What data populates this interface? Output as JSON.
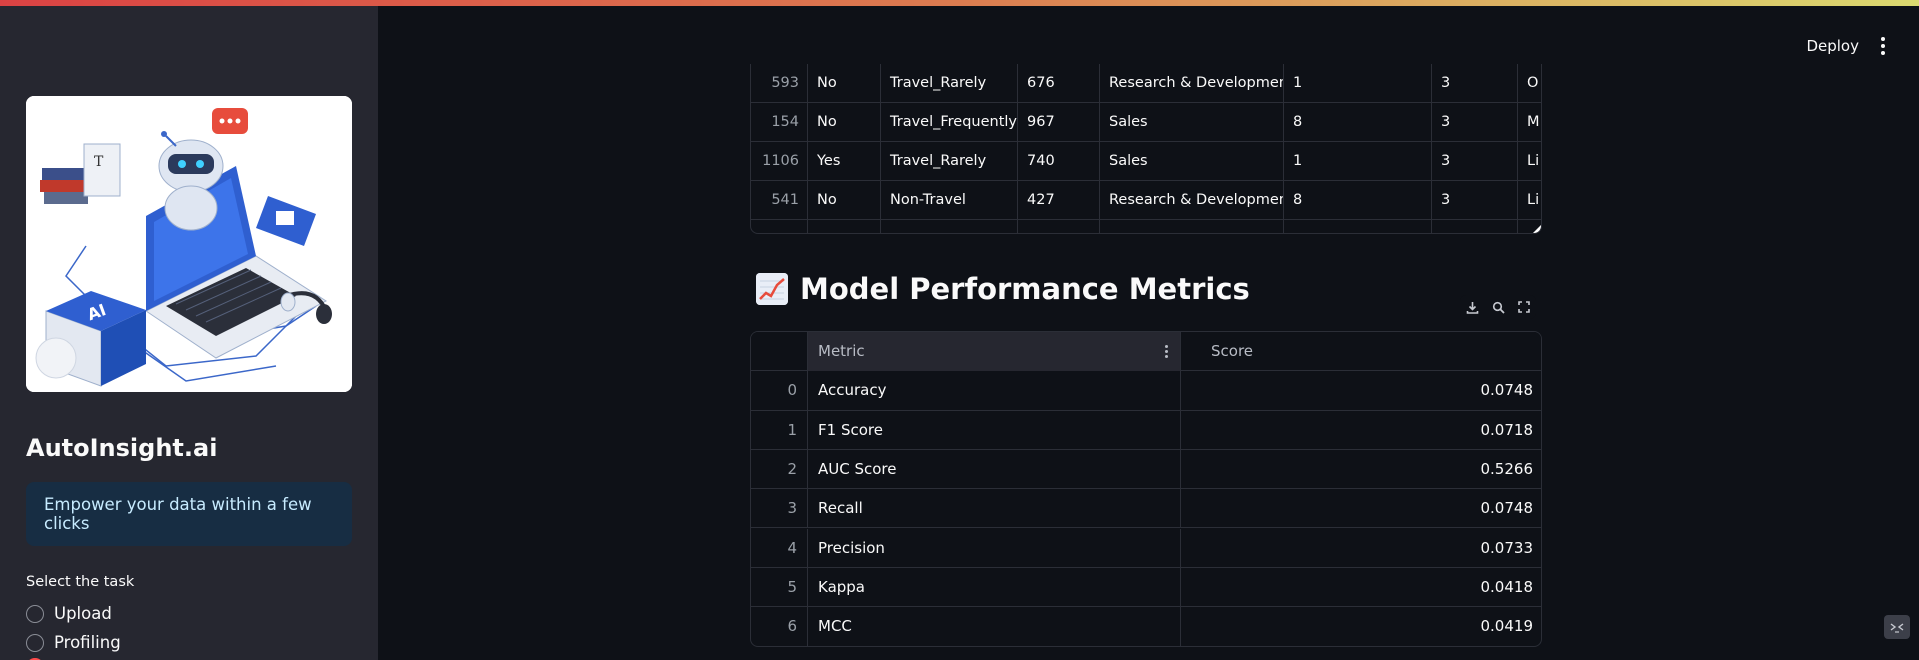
{
  "header": {
    "deploy_label": "Deploy",
    "menu_icon": "kebab-icon"
  },
  "sidebar": {
    "app_title": "AutoInsight.ai",
    "tagline": "Empower your data within a few clicks",
    "task_label": "Select the task",
    "tasks": [
      {
        "label": "Upload",
        "selected": false
      },
      {
        "label": "Profiling",
        "selected": false
      },
      {
        "label": "",
        "selected": true
      }
    ],
    "hero_image_text": "AI"
  },
  "dataset_preview": {
    "rows": [
      {
        "index": "593",
        "c1": "No",
        "c2": "Travel_Rarely",
        "c3": "676",
        "c4": "Research & Development",
        "c5": "1",
        "c6": "3",
        "c7": "O"
      },
      {
        "index": "154",
        "c1": "No",
        "c2": "Travel_Frequently",
        "c3": "967",
        "c4": "Sales",
        "c5": "8",
        "c6": "3",
        "c7": "M"
      },
      {
        "index": "1106",
        "c1": "Yes",
        "c2": "Travel_Rarely",
        "c3": "740",
        "c4": "Sales",
        "c5": "1",
        "c6": "3",
        "c7": "Li"
      },
      {
        "index": "541",
        "c1": "No",
        "c2": "Non-Travel",
        "c3": "427",
        "c4": "Research & Development",
        "c5": "8",
        "c6": "3",
        "c7": "Li"
      }
    ]
  },
  "metrics": {
    "section_title": "Model Performance Metrics",
    "section_icon": "chart-increasing-emoji",
    "columns": {
      "metric": "Metric",
      "score": "Score"
    },
    "toolbar_icons": [
      "download-icon",
      "search-icon",
      "fullscreen-icon"
    ],
    "rows": [
      {
        "index": "0",
        "metric": "Accuracy",
        "score": "0.0748"
      },
      {
        "index": "1",
        "metric": "F1 Score",
        "score": "0.0718"
      },
      {
        "index": "2",
        "metric": "AUC Score",
        "score": "0.5266"
      },
      {
        "index": "3",
        "metric": "Recall",
        "score": "0.0748"
      },
      {
        "index": "4",
        "metric": "Precision",
        "score": "0.0733"
      },
      {
        "index": "5",
        "metric": "Kappa",
        "score": "0.0418"
      },
      {
        "index": "6",
        "metric": "MCC",
        "score": "0.0419"
      }
    ]
  },
  "colors": {
    "background": "#0e1117",
    "sidebar": "#262730",
    "accent": "#ff4b4b",
    "info_box": "#172d43"
  }
}
